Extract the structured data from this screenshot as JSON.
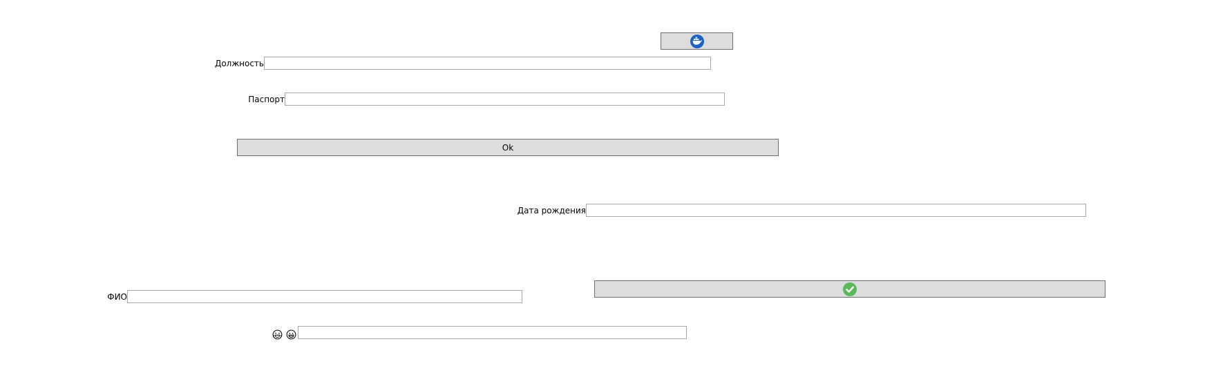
{
  "form": {
    "position": {
      "label": "Должность",
      "value": "",
      "placeholder": ""
    },
    "passport": {
      "label": "Паспорт",
      "value": "",
      "placeholder": ""
    },
    "ok_button": {
      "label": "Ok"
    },
    "birth_date": {
      "label": "Дата рождения",
      "value": "",
      "placeholder": ""
    },
    "full_name": {
      "label": "ФИО",
      "value": "",
      "placeholder": ""
    },
    "emoji_field": {
      "value": "",
      "placeholder": ""
    }
  },
  "icons": {
    "top_button_icon": "docker-whale-icon",
    "confirm_button_icon": "check-circle-icon",
    "emoji_1": "crying-laughing-face-icon",
    "emoji_2": "grinning-face-icon"
  },
  "colors": {
    "button_bg": "#dddddd",
    "button_border": "#6e6e6e",
    "input_border": "#a6a6a6",
    "docker_blue": "#1d63c2",
    "check_green": "#5cb85c"
  }
}
